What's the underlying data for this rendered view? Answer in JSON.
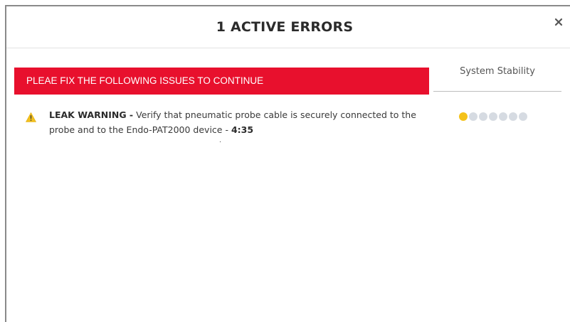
{
  "modal": {
    "title": "1 ACTIVE ERRORS",
    "close_icon": "close-icon"
  },
  "banner": {
    "text": "PLEAE FIX THE FOLLOWING ISSUES TO CONTINUE",
    "color": "#e8102d"
  },
  "stability": {
    "label": "System Stability",
    "level": 1,
    "total": 7,
    "active_color": "#f4c21a",
    "inactive_color": "#d6dbe2"
  },
  "errors": [
    {
      "icon": "warning-icon",
      "title": "LEAK WARNING -",
      "message": "Verify that pneumatic probe cable is securely connected to the probe and to the Endo-PAT2000 device -",
      "time": "4:35"
    }
  ]
}
